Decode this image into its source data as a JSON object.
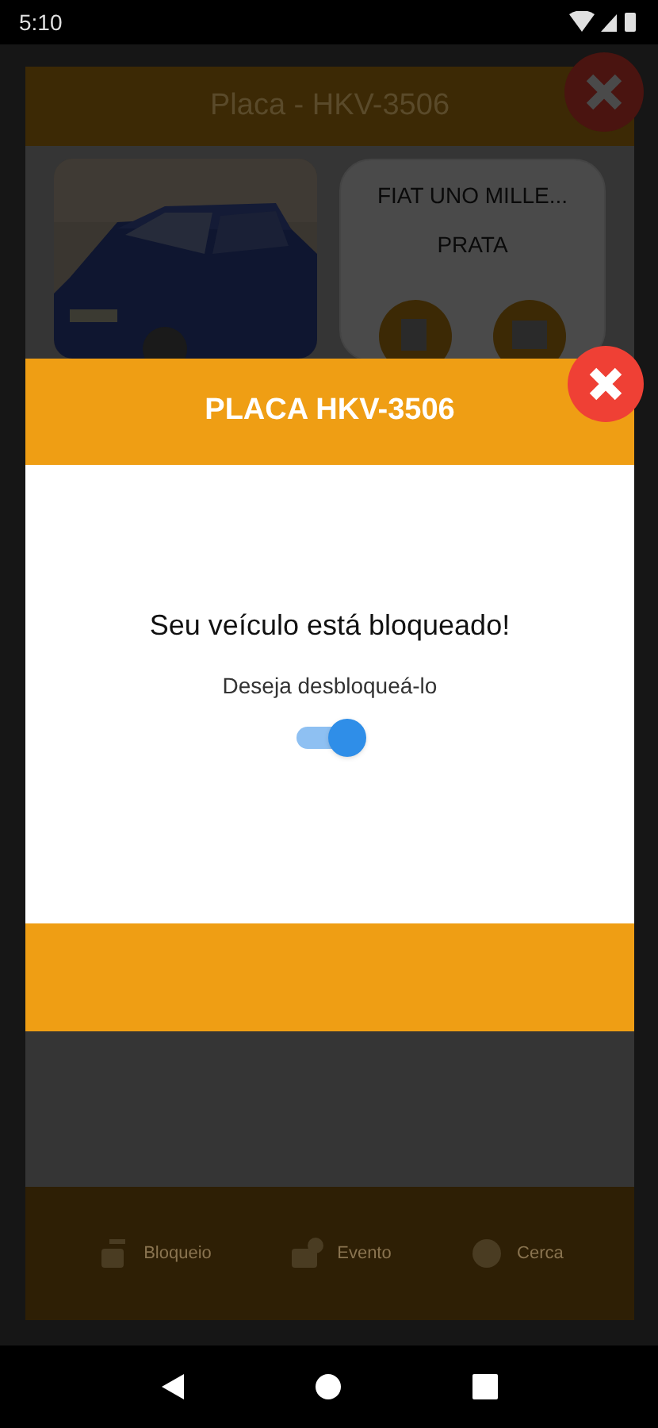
{
  "status_bar": {
    "time": "5:10"
  },
  "background": {
    "title": "Placa - HKV-3506",
    "vehicle": {
      "model": "FIAT UNO MILLE...",
      "color_name": "PRATA"
    },
    "tabs": [
      {
        "label": "Bloqueio"
      },
      {
        "label": "Evento"
      },
      {
        "label": "Cerca"
      }
    ]
  },
  "dialog": {
    "title": "PLACA HKV-3506",
    "message": "Seu veículo está bloqueado!",
    "toggle": {
      "label": "Deseja desbloqueá-lo",
      "on": true
    }
  }
}
